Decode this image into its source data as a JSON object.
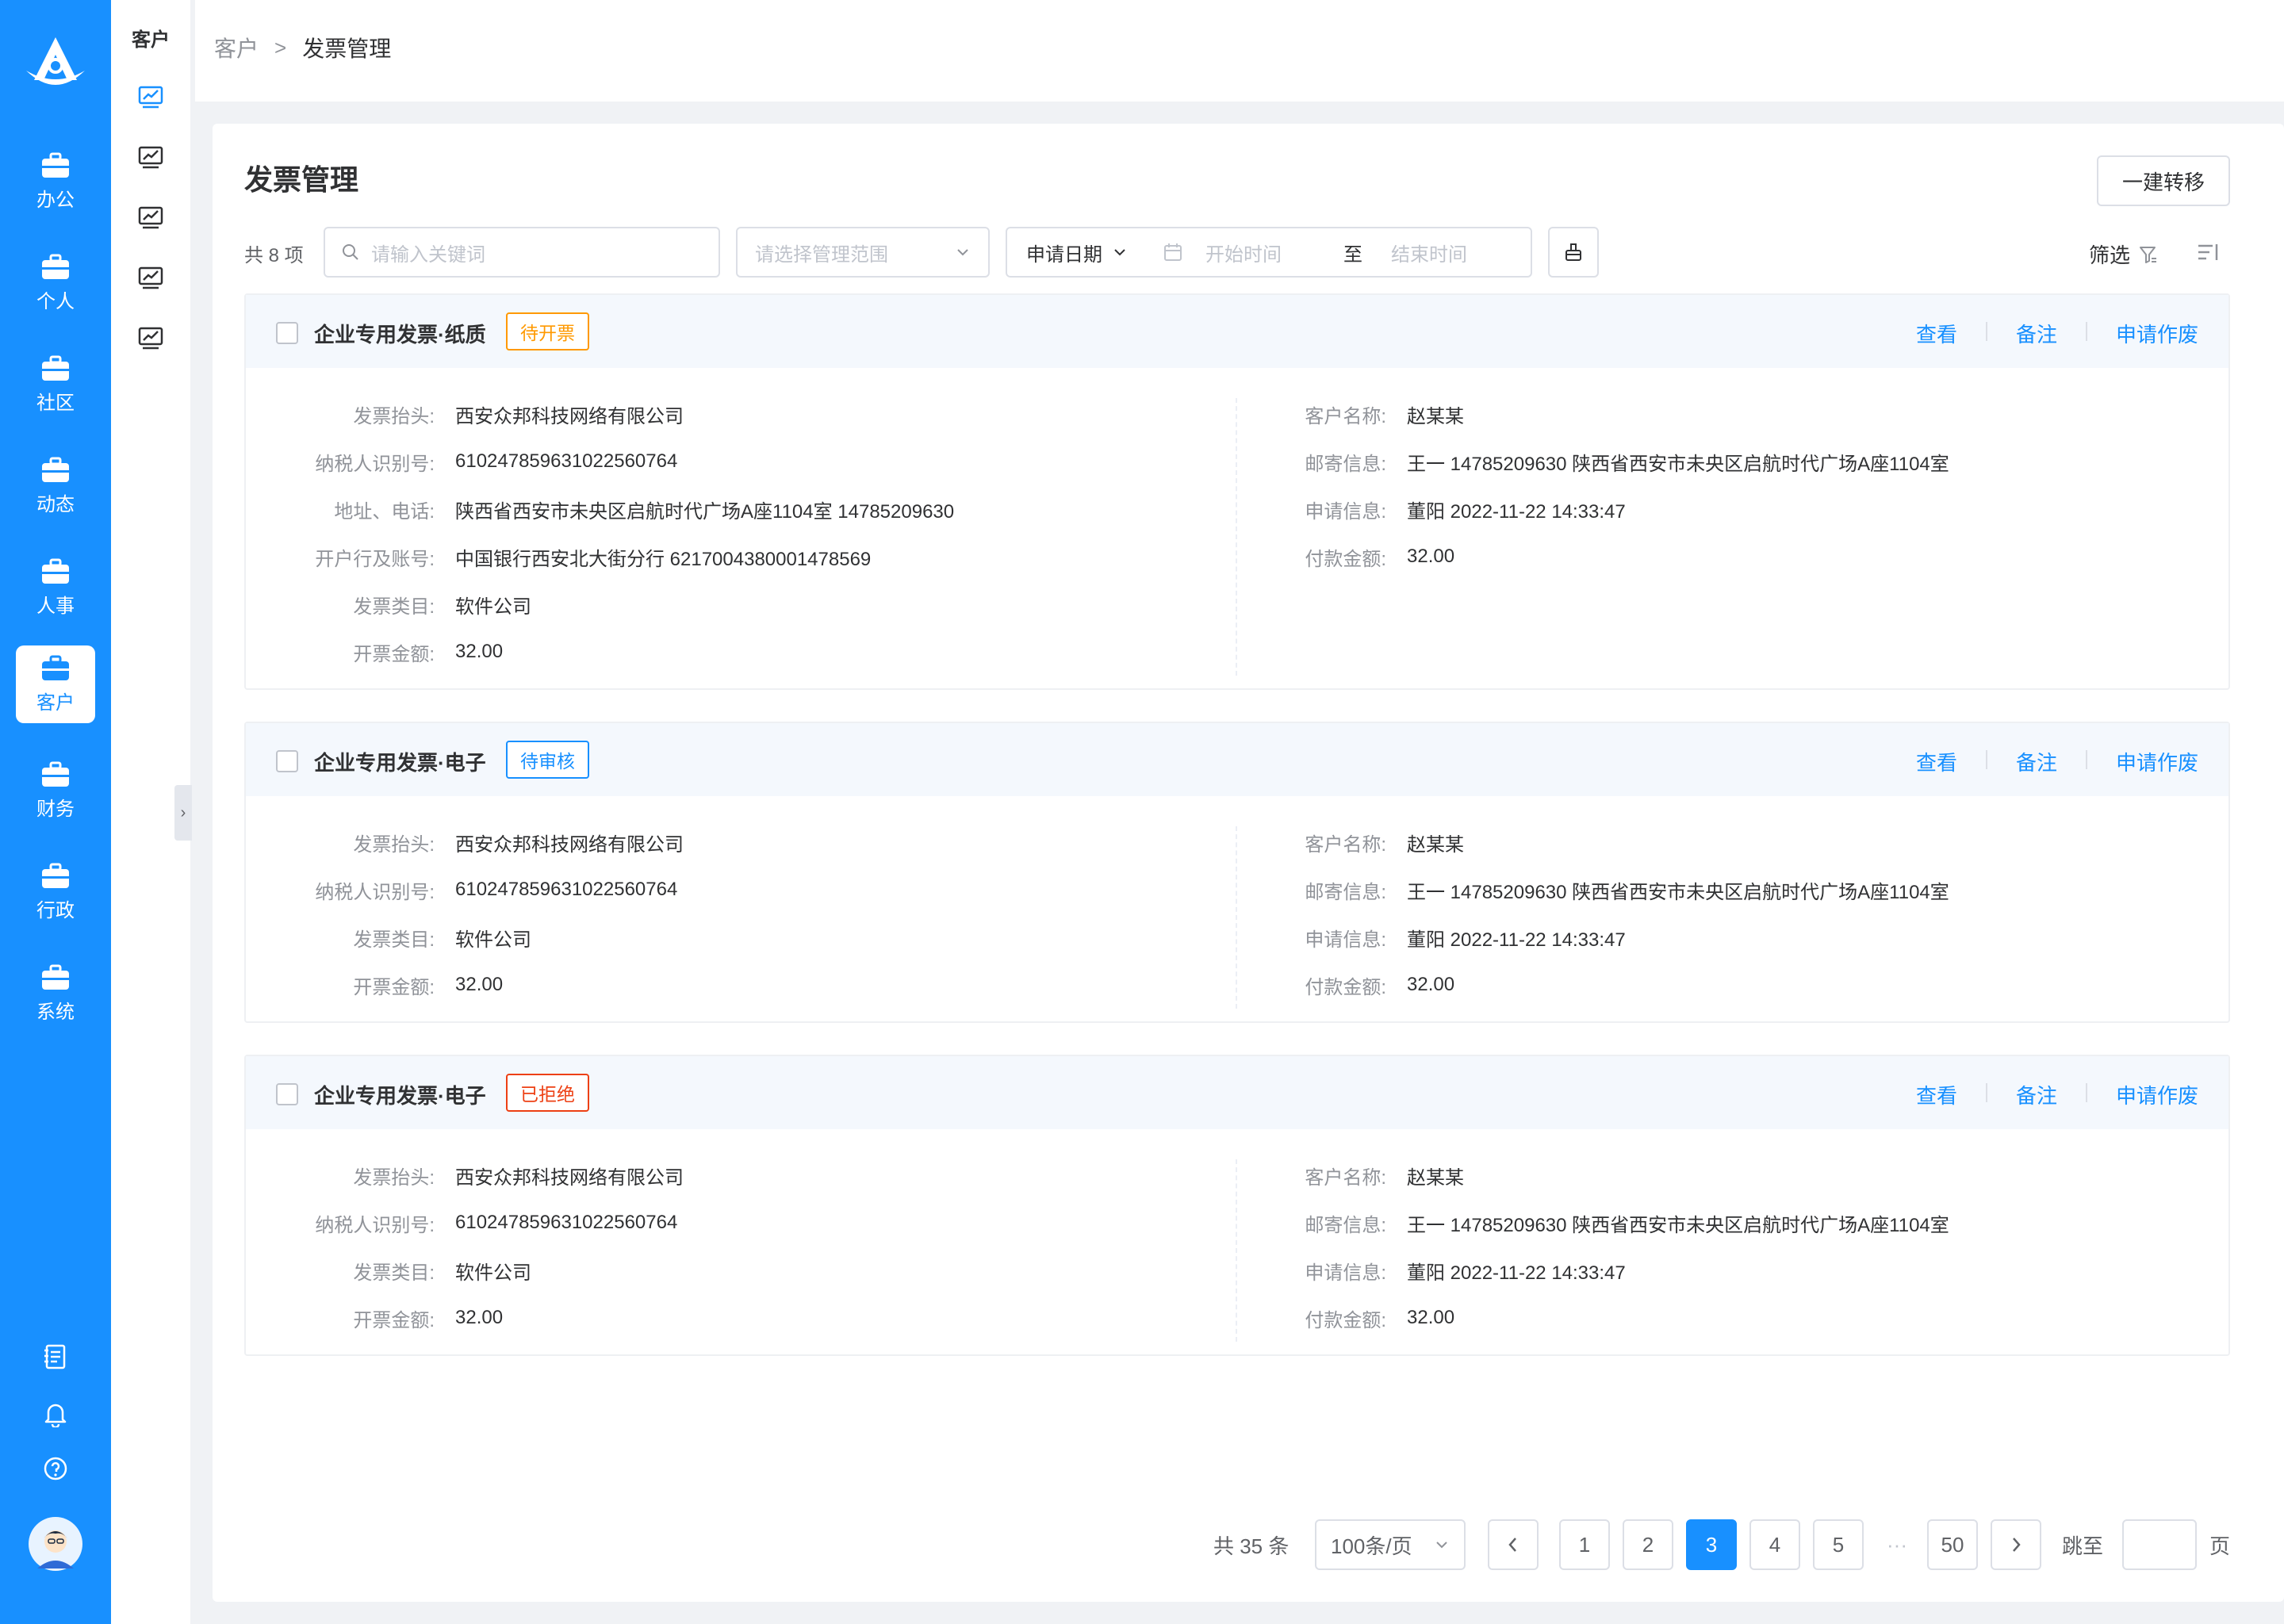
{
  "nav": {
    "items": [
      {
        "label": "办公",
        "icon": "briefcase-icon"
      },
      {
        "label": "个人",
        "icon": "briefcase-icon"
      },
      {
        "label": "社区",
        "icon": "briefcase-icon"
      },
      {
        "label": "动态",
        "icon": "briefcase-icon"
      },
      {
        "label": "人事",
        "icon": "briefcase-icon"
      },
      {
        "label": "客户",
        "icon": "briefcase-icon",
        "active": true
      },
      {
        "label": "财务",
        "icon": "briefcase-icon"
      },
      {
        "label": "行政",
        "icon": "briefcase-icon"
      },
      {
        "label": "系统",
        "icon": "briefcase-icon"
      }
    ],
    "accent": "#1890ff"
  },
  "subnav": {
    "title": "客户"
  },
  "breadcrumb": {
    "parent": "客户",
    "separator": ">",
    "current": "发票管理"
  },
  "page": {
    "title": "发票管理",
    "transfer_button": "一建转移"
  },
  "toolbar": {
    "total": "共 8 项",
    "search_placeholder": "请输入关键词",
    "scope_placeholder": "请选择管理范围",
    "date_type": "申请日期",
    "start_placeholder": "开始时间",
    "range_sep": "至",
    "end_placeholder": "结束时间",
    "filter_label": "筛选"
  },
  "invoices": [
    {
      "title": "企业专用发票·纸质",
      "status": "待开票",
      "status_color": "#ff9900",
      "actions": [
        "查看",
        "备注",
        "申请作废"
      ],
      "left": [
        {
          "label": "发票抬头:",
          "value": "西安众邦科技网络有限公司"
        },
        {
          "label": "纳税人识别号:",
          "value": "610247859631022560764"
        },
        {
          "label": "地址、电话:",
          "value": "陕西省西安市未央区启航时代广场A座1104室  14785209630"
        },
        {
          "label": "开户行及账号:",
          "value": "中国银行西安北大街分行  6217004380001478569"
        },
        {
          "label": "发票类目:",
          "value": "软件公司"
        },
        {
          "label": "开票金额:",
          "value": "32.00"
        }
      ],
      "right": [
        {
          "label": "客户名称:",
          "value": "赵某某"
        },
        {
          "label": "邮寄信息:",
          "value": "王一  14785209630  陕西省西安市未央区启航时代广场A座1104室"
        },
        {
          "label": "申请信息:",
          "value": "董阳  2022-11-22 14:33:47"
        },
        {
          "label": "付款金额:",
          "value": "32.00"
        }
      ]
    },
    {
      "title": "企业专用发票·电子",
      "status": "待审核",
      "status_color": "#1890ff",
      "actions": [
        "查看",
        "备注",
        "申请作废"
      ],
      "left": [
        {
          "label": "发票抬头:",
          "value": "西安众邦科技网络有限公司"
        },
        {
          "label": "纳税人识别号:",
          "value": "610247859631022560764"
        },
        {
          "label": "发票类目:",
          "value": "软件公司"
        },
        {
          "label": "开票金额:",
          "value": "32.00"
        }
      ],
      "right": [
        {
          "label": "客户名称:",
          "value": "赵某某"
        },
        {
          "label": "邮寄信息:",
          "value": "王一  14785209630  陕西省西安市未央区启航时代广场A座1104室"
        },
        {
          "label": "申请信息:",
          "value": "董阳  2022-11-22 14:33:47"
        },
        {
          "label": "付款金额:",
          "value": "32.00"
        }
      ]
    },
    {
      "title": "企业专用发票·电子",
      "status": "已拒绝",
      "status_color": "#ed4014",
      "actions": [
        "查看",
        "备注",
        "申请作废"
      ],
      "left": [
        {
          "label": "发票抬头:",
          "value": "西安众邦科技网络有限公司"
        },
        {
          "label": "纳税人识别号:",
          "value": "610247859631022560764"
        },
        {
          "label": "发票类目:",
          "value": "软件公司"
        },
        {
          "label": "开票金额:",
          "value": "32.00"
        }
      ],
      "right": [
        {
          "label": "客户名称:",
          "value": "赵某某"
        },
        {
          "label": "邮寄信息:",
          "value": "王一  14785209630  陕西省西安市未央区启航时代广场A座1104室"
        },
        {
          "label": "申请信息:",
          "value": "董阳  2022-11-22 14:33:47"
        },
        {
          "label": "付款金额:",
          "value": "32.00"
        }
      ]
    }
  ],
  "pagination": {
    "total": "共 35 条",
    "page_size": "100条/页",
    "pages": [
      "1",
      "2",
      "3",
      "4",
      "5"
    ],
    "current": "3",
    "ellipsis": "···",
    "last": "50",
    "jump_label": "跳至",
    "page_suffix": "页"
  }
}
